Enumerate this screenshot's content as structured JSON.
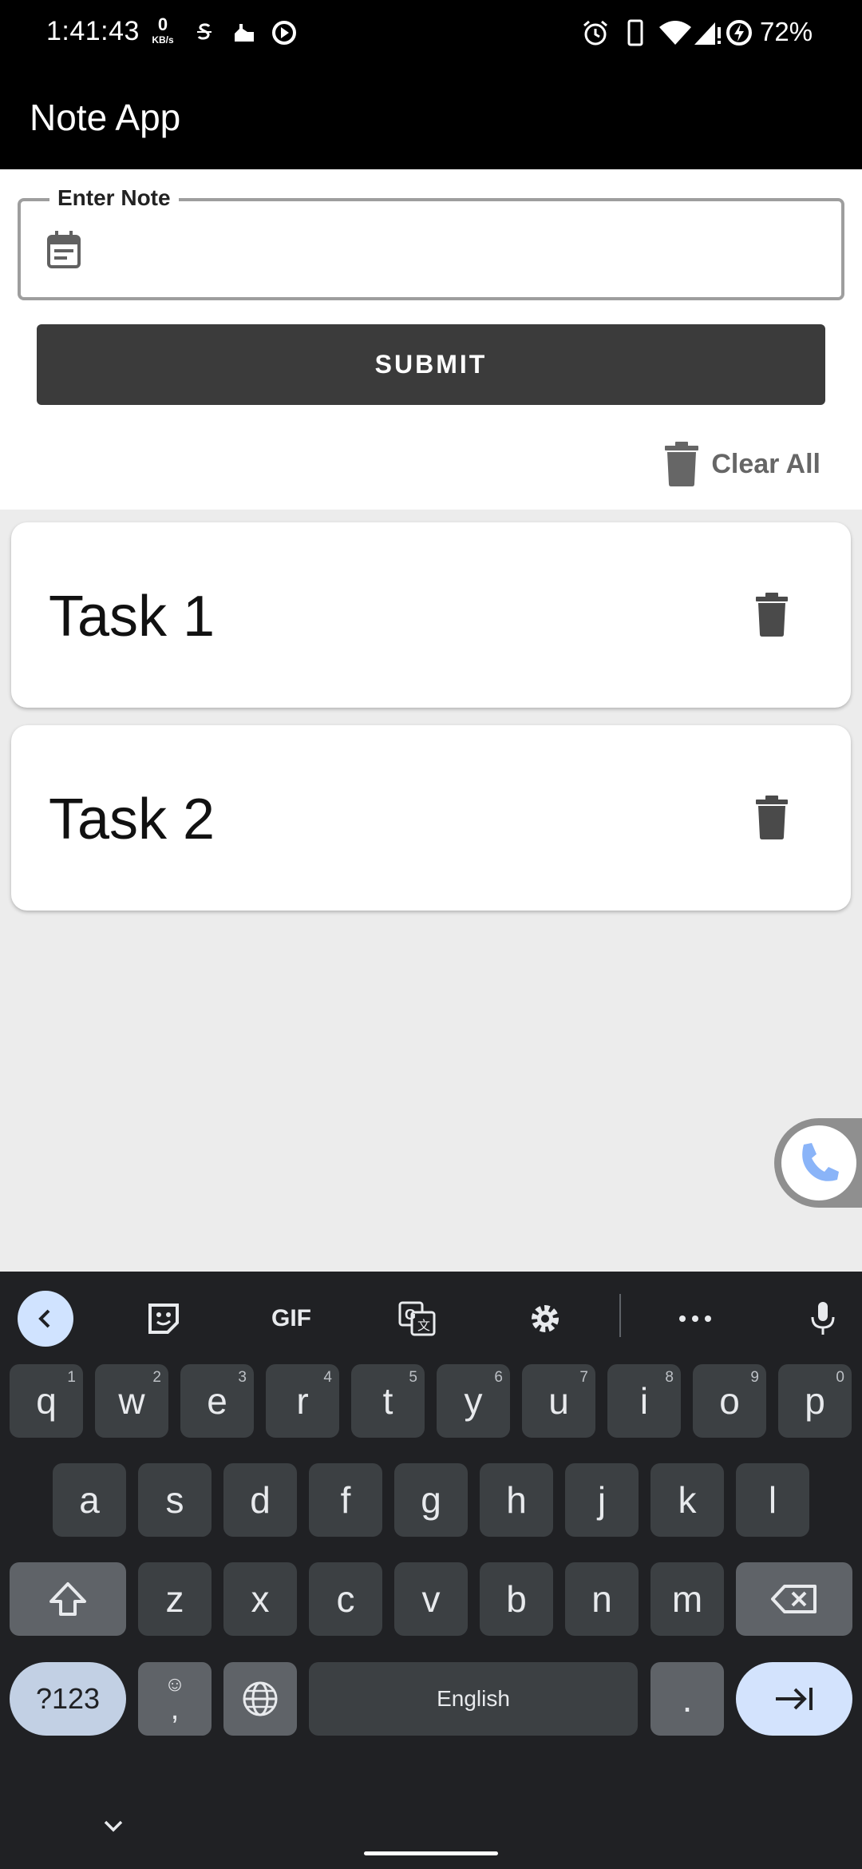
{
  "status_bar": {
    "time": "1:41:43",
    "net_speed_value": "0",
    "net_speed_unit": "KB/s",
    "battery": "72%"
  },
  "app": {
    "title": "Note App"
  },
  "form": {
    "input_label": "Enter Note",
    "input_value": "",
    "submit_label": "SUBMIT",
    "clear_all_label": "Clear All"
  },
  "tasks": [
    {
      "text": "Task 1"
    },
    {
      "text": "Task 2"
    }
  ],
  "keyboard": {
    "row1": [
      {
        "key": "q",
        "hint": "1"
      },
      {
        "key": "w",
        "hint": "2"
      },
      {
        "key": "e",
        "hint": "3"
      },
      {
        "key": "r",
        "hint": "4"
      },
      {
        "key": "t",
        "hint": "5"
      },
      {
        "key": "y",
        "hint": "6"
      },
      {
        "key": "u",
        "hint": "7"
      },
      {
        "key": "i",
        "hint": "8"
      },
      {
        "key": "o",
        "hint": "9"
      },
      {
        "key": "p",
        "hint": "0"
      }
    ],
    "row2": [
      "a",
      "s",
      "d",
      "f",
      "g",
      "h",
      "j",
      "k",
      "l"
    ],
    "row3": [
      "z",
      "x",
      "c",
      "v",
      "b",
      "n",
      "m"
    ],
    "toolbar": {
      "gif_label": "GIF"
    },
    "symbols_label": "?123",
    "comma_label": ",",
    "emoji_label": "☺",
    "space_label": "English",
    "period_label": "."
  },
  "colors": {
    "app_bar": "#000000",
    "submit_button": "#3b3b3b",
    "keyboard_bg": "#202124",
    "key_bg": "#3c4043",
    "accent_blue": "#d3e3fd"
  }
}
